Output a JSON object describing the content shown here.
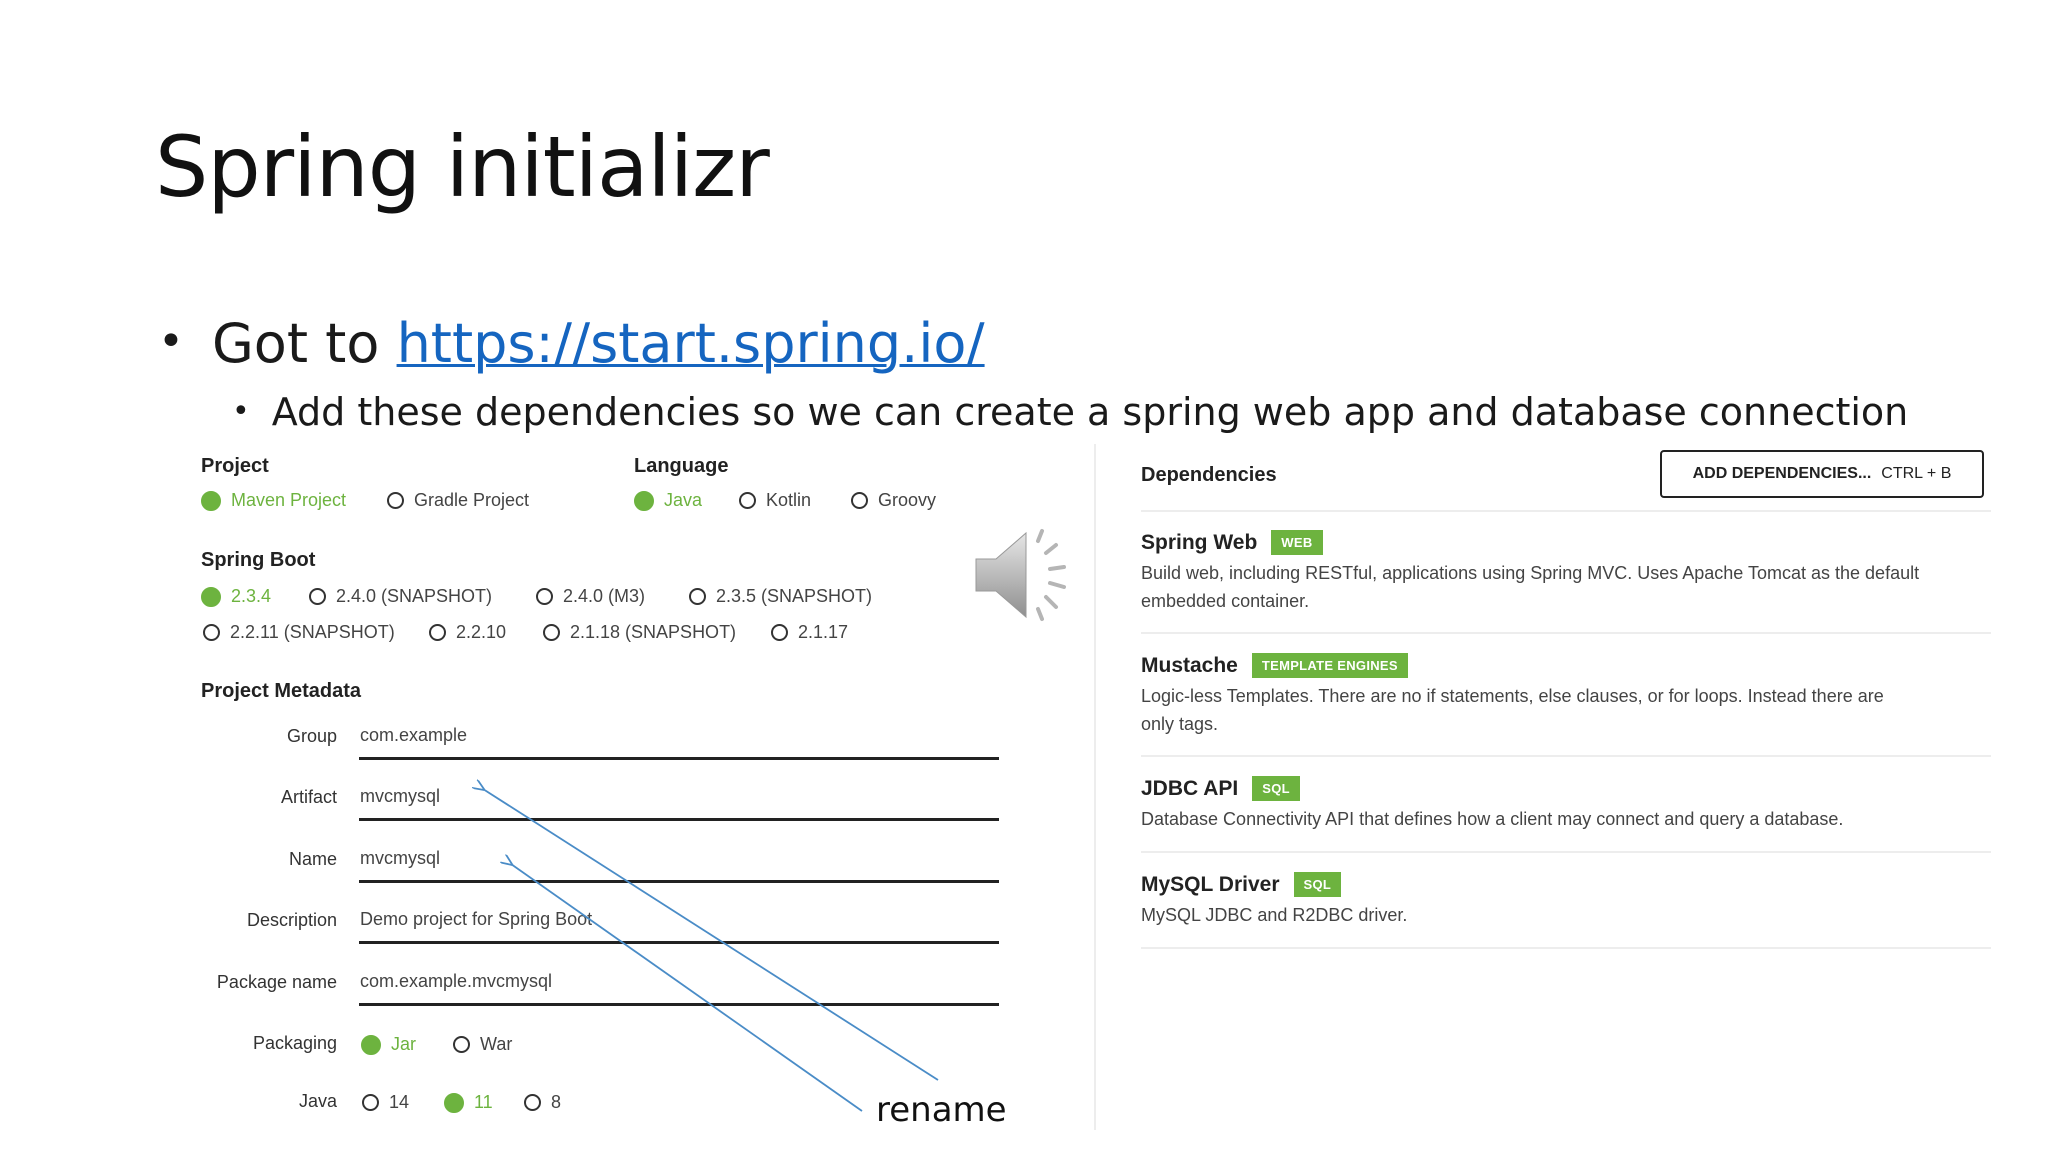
{
  "slide": {
    "title": "Spring initializr",
    "bullet1_prefix": "Got to",
    "bullet1_link": "https://start.spring.io/",
    "bullet2": "Add these dependencies so we can create a spring web app and database connection",
    "annotation": "rename"
  },
  "initializr": {
    "project": {
      "label": "Project",
      "options": [
        {
          "label": "Maven Project",
          "selected": true
        },
        {
          "label": "Gradle Project",
          "selected": false
        }
      ]
    },
    "language": {
      "label": "Language",
      "options": [
        {
          "label": "Java",
          "selected": true
        },
        {
          "label": "Kotlin",
          "selected": false
        },
        {
          "label": "Groovy",
          "selected": false
        }
      ]
    },
    "spring_boot": {
      "label": "Spring Boot",
      "options": [
        {
          "label": "2.3.4",
          "selected": true
        },
        {
          "label": "2.4.0 (SNAPSHOT)",
          "selected": false
        },
        {
          "label": "2.4.0 (M3)",
          "selected": false
        },
        {
          "label": "2.3.5 (SNAPSHOT)",
          "selected": false
        },
        {
          "label": "2.2.11 (SNAPSHOT)",
          "selected": false
        },
        {
          "label": "2.2.10",
          "selected": false
        },
        {
          "label": "2.1.18 (SNAPSHOT)",
          "selected": false
        },
        {
          "label": "2.1.17",
          "selected": false
        }
      ]
    },
    "metadata": {
      "label": "Project Metadata",
      "group": {
        "label": "Group",
        "value": "com.example"
      },
      "artifact": {
        "label": "Artifact",
        "value": "mvcmysql"
      },
      "name": {
        "label": "Name",
        "value": "mvcmysql"
      },
      "description": {
        "label": "Description",
        "value": "Demo project for Spring Boot"
      },
      "package_name": {
        "label": "Package name",
        "value": "com.example.mvcmysql"
      },
      "packaging": {
        "label": "Packaging",
        "options": [
          {
            "label": "Jar",
            "selected": true
          },
          {
            "label": "War",
            "selected": false
          }
        ]
      },
      "java": {
        "label": "Java",
        "options": [
          {
            "label": "14",
            "selected": false
          },
          {
            "label": "11",
            "selected": true
          },
          {
            "label": "8",
            "selected": false
          }
        ]
      }
    },
    "dependencies": {
      "label": "Dependencies",
      "add_button": "ADD DEPENDENCIES...",
      "add_shortcut": "CTRL + B",
      "items": [
        {
          "name": "Spring Web",
          "tag": "WEB",
          "desc": "Build web, including RESTful, applications using Spring MVC. Uses Apache Tomcat as the default embedded container."
        },
        {
          "name": "Mustache",
          "tag": "TEMPLATE ENGINES",
          "desc": "Logic-less Templates. There are no if statements, else clauses, or for loops. Instead there are only tags."
        },
        {
          "name": "JDBC API",
          "tag": "SQL",
          "desc": "Database Connectivity API that defines how a client may connect and query a database."
        },
        {
          "name": "MySQL Driver",
          "tag": "SQL",
          "desc": "MySQL JDBC and R2DBC driver."
        }
      ]
    }
  },
  "colors": {
    "accent_green": "#6db33f",
    "link_blue": "#1565c0",
    "arrow_blue": "#4a8cc7"
  },
  "icons": {
    "speaker": "speaker-audio-icon"
  }
}
